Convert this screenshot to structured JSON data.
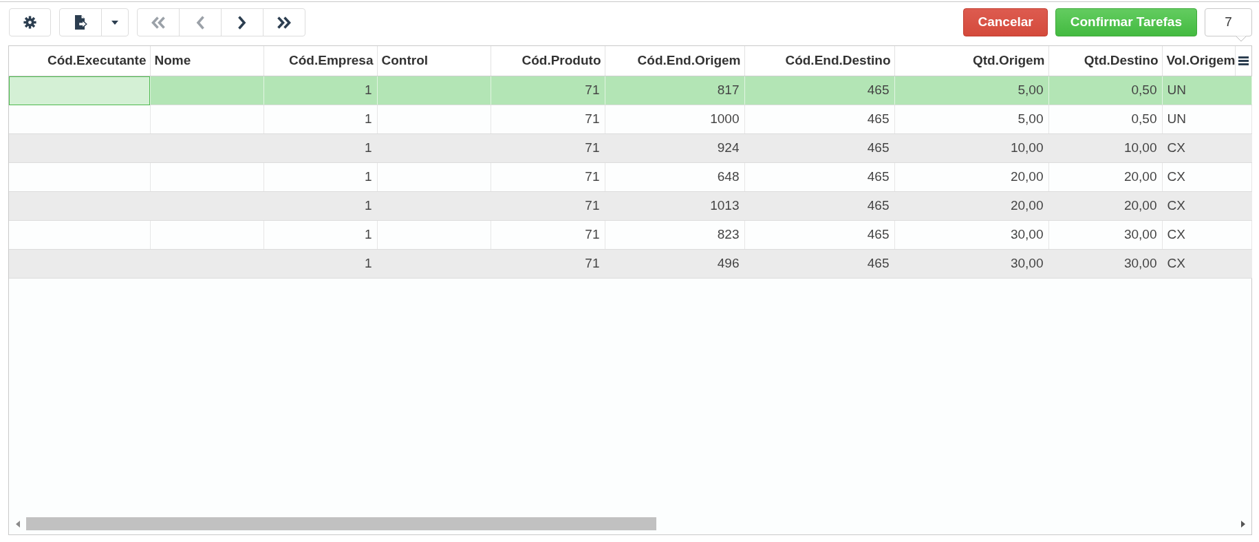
{
  "toolbar": {
    "pager": [
      {
        "kind": "first",
        "disabled": true
      },
      {
        "kind": "previous",
        "disabled": true
      },
      {
        "kind": "next",
        "disabled": false
      },
      {
        "kind": "last",
        "disabled": false
      }
    ]
  },
  "actions": [
    {
      "label": "Cancelar",
      "kind": "cancel"
    },
    {
      "label": "Confirmar Tarefas",
      "kind": "confirm"
    }
  ],
  "record_count": "7",
  "table": {
    "columns": [
      {
        "label": "Cód.Executante",
        "kind": "number"
      },
      {
        "label": "Nome",
        "kind": "text"
      },
      {
        "label": "Cód.Empresa",
        "kind": "number"
      },
      {
        "label": "Control",
        "kind": "text"
      },
      {
        "label": "Cód.Produto",
        "kind": "number"
      },
      {
        "label": "Cód.End.Origem",
        "kind": "number"
      },
      {
        "label": "Cód.End.Destino",
        "kind": "number"
      },
      {
        "label": "Qtd.Origem",
        "kind": "number"
      },
      {
        "label": "Qtd.Destino",
        "kind": "number"
      },
      {
        "label": "Vol.Origem",
        "kind": "text"
      }
    ],
    "rows": [
      {
        "selected": true,
        "focused": true,
        "cells": [
          null,
          null,
          "1",
          null,
          "71",
          "817",
          "465",
          "5,00",
          "0,50",
          "UN"
        ]
      },
      {
        "selected": false,
        "focused": false,
        "cells": [
          null,
          null,
          "1",
          null,
          "71",
          "1000",
          "465",
          "5,00",
          "0,50",
          "UN"
        ]
      },
      {
        "selected": false,
        "focused": false,
        "cells": [
          null,
          null,
          "1",
          null,
          "71",
          "924",
          "465",
          "10,00",
          "10,00",
          "CX"
        ]
      },
      {
        "selected": false,
        "focused": false,
        "cells": [
          null,
          null,
          "1",
          null,
          "71",
          "648",
          "465",
          "20,00",
          "20,00",
          "CX"
        ]
      },
      {
        "selected": false,
        "focused": false,
        "cells": [
          null,
          null,
          "1",
          null,
          "71",
          "1013",
          "465",
          "20,00",
          "20,00",
          "CX"
        ]
      },
      {
        "selected": false,
        "focused": false,
        "cells": [
          null,
          null,
          "1",
          null,
          "71",
          "823",
          "465",
          "30,00",
          "30,00",
          "CX"
        ]
      },
      {
        "selected": false,
        "focused": false,
        "cells": [
          null,
          null,
          "1",
          null,
          "71",
          "496",
          "465",
          "30,00",
          "30,00",
          "CX"
        ]
      }
    ]
  }
}
